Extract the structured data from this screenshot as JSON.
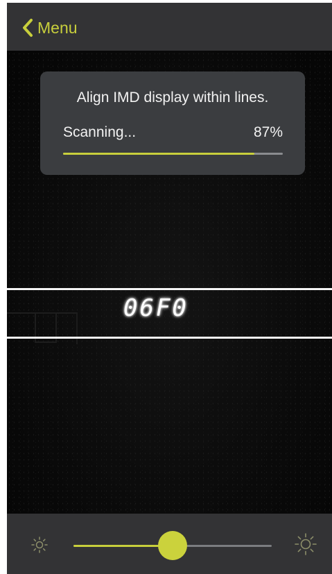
{
  "nav": {
    "back_label": "Menu",
    "back_icon": "chevron-left-icon"
  },
  "status": {
    "instruction": "Align IMD display within lines.",
    "scan_label": "Scanning...",
    "percent_text": "87%",
    "progress_fraction": 0.87
  },
  "camera": {
    "readout": "06F0"
  },
  "brightness": {
    "low_icon": "sun-small-icon",
    "high_icon": "sun-large-icon",
    "level_fraction": 0.5
  },
  "colors": {
    "accent": "#c8cf3c",
    "bar_background": "#333335",
    "card_background": "#3b3d40"
  }
}
